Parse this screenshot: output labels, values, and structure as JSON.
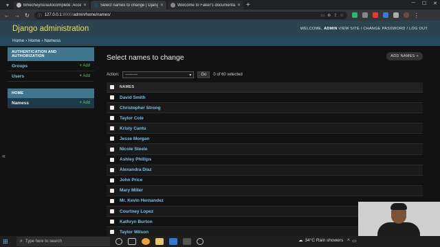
{
  "browser": {
    "tabs": [
      {
        "title": "bmecheyns/autocomplete: Accessible"
      },
      {
        "title": "Select names to change | Django site"
      },
      {
        "title": "Welcome to Faker's documentation"
      }
    ],
    "url_host": "127.0.0.1",
    "url_port": ":8000/",
    "url_path": "admin/home/names/"
  },
  "header": {
    "brand": "Django administration",
    "welcome": "WELCOME,",
    "user": "ADMIN",
    "links": "VIEW SITE / CHANGE PASSWORD / LOG OUT"
  },
  "breadcrumbs": "Home › Home › Namess",
  "sidebar": {
    "modules": [
      {
        "caption": "AUTHENTICATION AND AUTHORIZATION",
        "rows": [
          {
            "name": "Groups",
            "add": "Add"
          },
          {
            "name": "Users",
            "add": "Add"
          }
        ]
      },
      {
        "caption": "HOME",
        "rows": [
          {
            "name": "Namess",
            "add": "Add"
          }
        ]
      }
    ],
    "collapse": "«"
  },
  "content": {
    "title": "Select names to change",
    "add_button": "ADD NAMES",
    "action_label": "Action:",
    "action_value": "---------",
    "go": "Go",
    "selected": "0 of 60 selected",
    "column": "NAMES",
    "names": [
      "David Smith",
      "Christopher Strong",
      "Taylor Cole",
      "Kristy Cantu",
      "Jesse Morgan",
      "Nicole Steele",
      "Ashley Phillips",
      "Alexandra Diaz",
      "John Price",
      "Mary Miller",
      "Mr. Kevin Hernandez",
      "Courtney Lopez",
      "Kathryn Burton",
      "Taylor Wilson"
    ]
  },
  "taskbar": {
    "search_placeholder": "Type here to search",
    "weather": "34°C  Rain showers"
  },
  "colors": {
    "header_bg": "#2c4350",
    "brand": "#f5dd5d",
    "link": "#79c2e6",
    "add_green": "#5fbf5f",
    "module_caption": "#417690"
  }
}
